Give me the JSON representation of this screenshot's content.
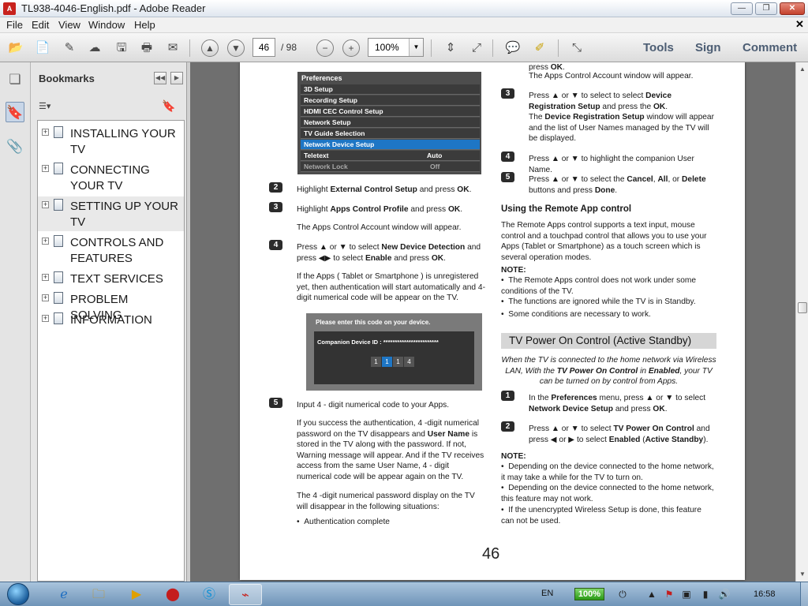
{
  "window": {
    "title": "TL938-4046-English.pdf - Adobe Reader",
    "app_icon": "pdf-icon",
    "min_glyph": "—",
    "max_glyph": "❐",
    "close_glyph": "✕"
  },
  "menubar": {
    "items": [
      "File",
      "Edit",
      "View",
      "Window",
      "Help"
    ],
    "close_doc": "✕"
  },
  "toolbar": {
    "page_current": "46",
    "page_total": "/ 98",
    "zoom": "100%",
    "tools": "Tools",
    "sign": "Sign",
    "comment": "Comment"
  },
  "bookmarks": {
    "header": "Bookmarks",
    "items": [
      {
        "label": "INSTALLING YOUR TV"
      },
      {
        "label": "CONNECTING YOUR TV"
      },
      {
        "label": "SETTING UP YOUR TV"
      },
      {
        "label": "CONTROLS AND FEATURES"
      },
      {
        "label": "TEXT SERVICES"
      },
      {
        "label": "PROBLEM SOLVING"
      },
      {
        "label": "INFORMATION"
      }
    ],
    "selected_index": 2
  },
  "page": {
    "number": "46",
    "menu_box": {
      "title": "Preferences",
      "items": [
        "3D Setup",
        "Recording Setup",
        "HDMI CEC Control Setup",
        "Network Setup",
        "TV Guide Selection",
        "Network Device Setup"
      ],
      "highlighted": "Network Device Setup",
      "teletext_label": "Teletext",
      "teletext_value": "Auto",
      "network_lock_label": "Network Lock",
      "network_lock_value": "Off"
    },
    "left": {
      "step2": "2",
      "step2_text_a": "Highlight ",
      "step2_bold": "External Control Setup",
      "step2_text_b": " and press ",
      "step2_ok": "OK",
      "step2_end": ".",
      "step3": "3",
      "step3_text_a": "Highlight ",
      "step3_bold": "Apps Control Profile",
      "step3_text_b": " and press ",
      "step3_ok": "OK",
      "step3_end": ".",
      "step3_sub": "The Apps Control Account window will appear.",
      "step4": "4",
      "step4_a": "Press ▲ or ▼ to select ",
      "step4_bold1": "New Device Detection",
      "step4_b": " and press ◀▶ to select ",
      "step4_bold2": "Enable",
      "step4_c": "  and press ",
      "step4_ok": "OK",
      "step4_end": ".",
      "step4_sub": "If the Apps ( Tablet or Smartphone ) is unregistered yet, then authentication will start automatically and 4-digit numerical code will be appear on the TV.",
      "code_title": "Please enter this code on your device.",
      "code_label": "Companion Device ID : ************************",
      "code_digits": [
        "1",
        "1",
        "1",
        "4"
      ],
      "code_active_index": 1,
      "step5": "5",
      "step5_text": "Input 4 - digit numerical code to your Apps.",
      "para1_a": "If you success the authentication, 4 -digit numerical password on the TV disappears and ",
      "para1_bold": "User Name",
      "para1_b": " is stored in the TV along with the password. If not, Warning message will appear. And if the TV receives access from the same User Name, 4 - digit numerical code will be appear again on the TV.",
      "para2": "The 4 -digit numerical password display on the TV will disappear in the following situations:",
      "bullet1": "Authentication complete"
    },
    "right": {
      "top_a": "press ",
      "top_ok": "OK",
      "top_end": ".",
      "top_sub": "The Apps Control Account window will appear.",
      "step3": "3",
      "step3_a": "Press ▲ or ▼ to select to select ",
      "step3_bold": "Device Registration Setup",
      "step3_b": " and press the ",
      "step3_ok": "OK",
      "step3_end": ".",
      "step3_sub_a": "The ",
      "step3_sub_bold": "Device Registration Setup",
      "step3_sub_b": " window will appear and the list of User Names managed by the TV will be displayed.",
      "step4": "4",
      "step4_text": "Press ▲ or ▼ to highlight the companion User Name.",
      "step5": "5",
      "step5_a": "Press ▲ or ▼ to select the ",
      "step5_b1": "Cancel",
      "step5_c1": ", ",
      "step5_b2": "All",
      "step5_c2": ", or ",
      "step5_b3": "Delete",
      "step5_d": " buttons and press ",
      "step5_b4": "Done",
      "step5_end": ".",
      "remote_head": "Using the Remote App control",
      "remote_para": "The Remote Apps control supports a text input, mouse control and a touchpad control that allows you to use your Apps (Tablet or Smartphone) as a touch screen which is several operation modes.",
      "note1": "NOTE:",
      "note1_items": [
        "The Remote Apps control does not work under some conditions of the TV.",
        "The functions are ignored while the TV is in Standby.",
        "Some conditions are necessary to work."
      ],
      "standby_head": "TV Power On Control (Active Standby)",
      "standby_italic_a": "When the TV is connected to the home network via Wireless LAN, With the ",
      "standby_italic_b1": "TV Power On Control",
      "standby_italic_c": " in ",
      "standby_italic_b2": "Enabled",
      "standby_italic_d": ", your TV can be turned on by control from Apps.",
      "sb_step1": "1",
      "sb_step1_a": "In the ",
      "sb_step1_bold1": "Preferences",
      "sb_step1_b": " menu, press ▲ or ▼ to select ",
      "sb_step1_bold2": "Network Device Setup",
      "sb_step1_c": " and press ",
      "sb_step1_ok": "OK",
      "sb_step1_end": ".",
      "sb_step2": "2",
      "sb_step2_a": "Press ▲ or ▼ to select ",
      "sb_step2_bold1": "TV Power On Control",
      "sb_step2_b": " and press ◀ or ▶ to select ",
      "sb_step2_bold2": "Enabled",
      "sb_step2_c": " (",
      "sb_step2_bold3": "Active Standby",
      "sb_step2_end": ").",
      "note2": "NOTE:",
      "note2_items": [
        "Depending on the device connected to the home network, it may take a while for the TV to turn on.",
        "Depending on the device connected to the home network, this feature may not work.",
        "If the unencrypted Wireless Setup is done, this feature can not be used."
      ]
    }
  },
  "taskbar": {
    "lang": "EN",
    "battery": "100%",
    "clock": "16:58"
  },
  "colors": {
    "accent": "#1e76c5",
    "pdf_red": "#c8221d"
  }
}
